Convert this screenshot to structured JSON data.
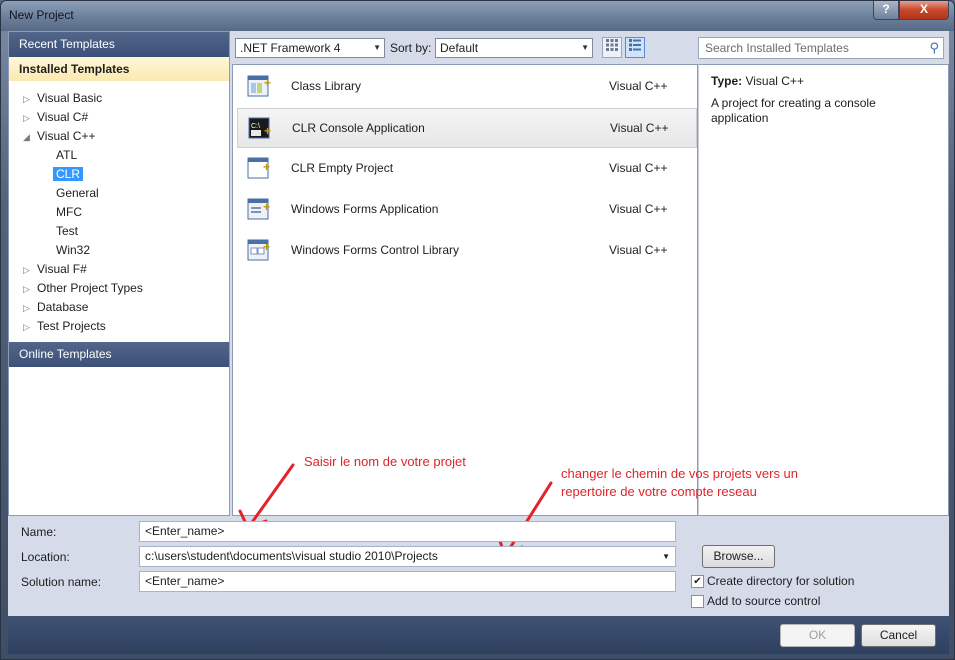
{
  "window": {
    "title": "New Project",
    "help_glyph": "?",
    "close_glyph": "X"
  },
  "sidebar": {
    "recent": "Recent Templates",
    "installed": "Installed Templates",
    "online": "Online Templates",
    "tree": [
      {
        "label": "Visual Basic",
        "expander": "▷"
      },
      {
        "label": "Visual C#",
        "expander": "▷"
      },
      {
        "label": "Visual C++",
        "expander": "◢"
      },
      {
        "label": "ATL"
      },
      {
        "label": "CLR",
        "selected": true
      },
      {
        "label": "General"
      },
      {
        "label": "MFC"
      },
      {
        "label": "Test"
      },
      {
        "label": "Win32"
      },
      {
        "label": "Visual F#",
        "expander": "▷"
      },
      {
        "label": "Other Project Types",
        "expander": "▷"
      },
      {
        "label": "Database",
        "expander": "▷"
      },
      {
        "label": "Test Projects",
        "expander": "▷"
      }
    ]
  },
  "toolbar": {
    "framework": ".NET Framework 4",
    "sort_label": "Sort by:",
    "sort_value": "Default",
    "search_placeholder": "Search Installed Templates"
  },
  "templates": [
    {
      "name": "Class Library",
      "lang": "Visual C++",
      "icon": "class-library-icon"
    },
    {
      "name": "CLR Console Application",
      "lang": "Visual C++",
      "icon": "console-app-icon",
      "selected": true
    },
    {
      "name": "CLR Empty Project",
      "lang": "Visual C++",
      "icon": "empty-project-icon"
    },
    {
      "name": "Windows Forms Application",
      "lang": "Visual C++",
      "icon": "forms-app-icon"
    },
    {
      "name": "Windows Forms Control Library",
      "lang": "Visual C++",
      "icon": "control-library-icon"
    }
  ],
  "details": {
    "type_label": "Type:",
    "type_value": "Visual C++",
    "description": "A project for creating a console application"
  },
  "annotations": {
    "name_hint": "Saisir le nom de votre projet",
    "location_hint": "changer le chemin de vos projets vers un repertoire de votre compte reseau",
    "color": "#e0242a"
  },
  "form": {
    "name_label": "Name:",
    "name_value": "<Enter_name>",
    "location_label": "Location:",
    "location_value": "c:\\users\\student\\documents\\visual studio 2010\\Projects",
    "solution_label": "Solution name:",
    "solution_value": "<Enter_name>",
    "browse_label": "Browse...",
    "create_dir_label": "Create directory for solution",
    "create_dir_checked": true,
    "source_control_label": "Add to source control",
    "source_control_checked": false
  },
  "buttons": {
    "ok": "OK",
    "cancel": "Cancel"
  }
}
